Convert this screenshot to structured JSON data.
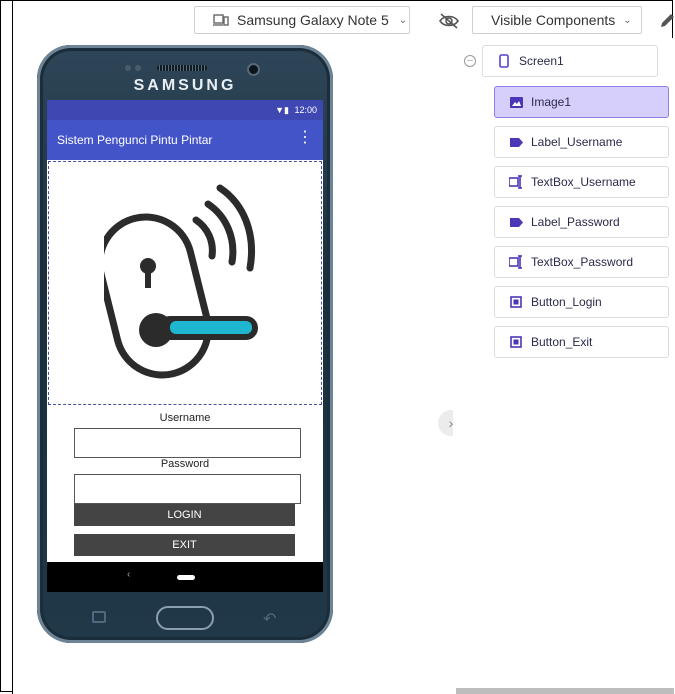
{
  "toolbar": {
    "device_label": "Samsung Galaxy Note 5",
    "visible_components_label": "Visible Components"
  },
  "phone": {
    "brand": "SAMSUNG",
    "status_time": "12:00",
    "app_title": "Sistem Pengunci Pintu Pintar",
    "username_label": "Username",
    "password_label": "Password",
    "login_label": "LOGIN",
    "exit_label": "EXIT",
    "nav_back": "‹"
  },
  "tree": {
    "root": "Screen1",
    "items": [
      {
        "label": "Image1",
        "icon": "image-icon",
        "selected": true
      },
      {
        "label": "Label_Username",
        "icon": "label-icon"
      },
      {
        "label": "TextBox_Username",
        "icon": "textbox-icon"
      },
      {
        "label": "Label_Password",
        "icon": "label-icon"
      },
      {
        "label": "TextBox_Password",
        "icon": "textbox-icon"
      },
      {
        "label": "Button_Login",
        "icon": "button-icon"
      },
      {
        "label": "Button_Exit",
        "icon": "button-icon"
      }
    ]
  },
  "colors": {
    "appbar": "#4353c8",
    "statusbar": "#3f47b3",
    "tree_accent": "#6a4fd8",
    "selected_bg": "#d6cffb"
  }
}
